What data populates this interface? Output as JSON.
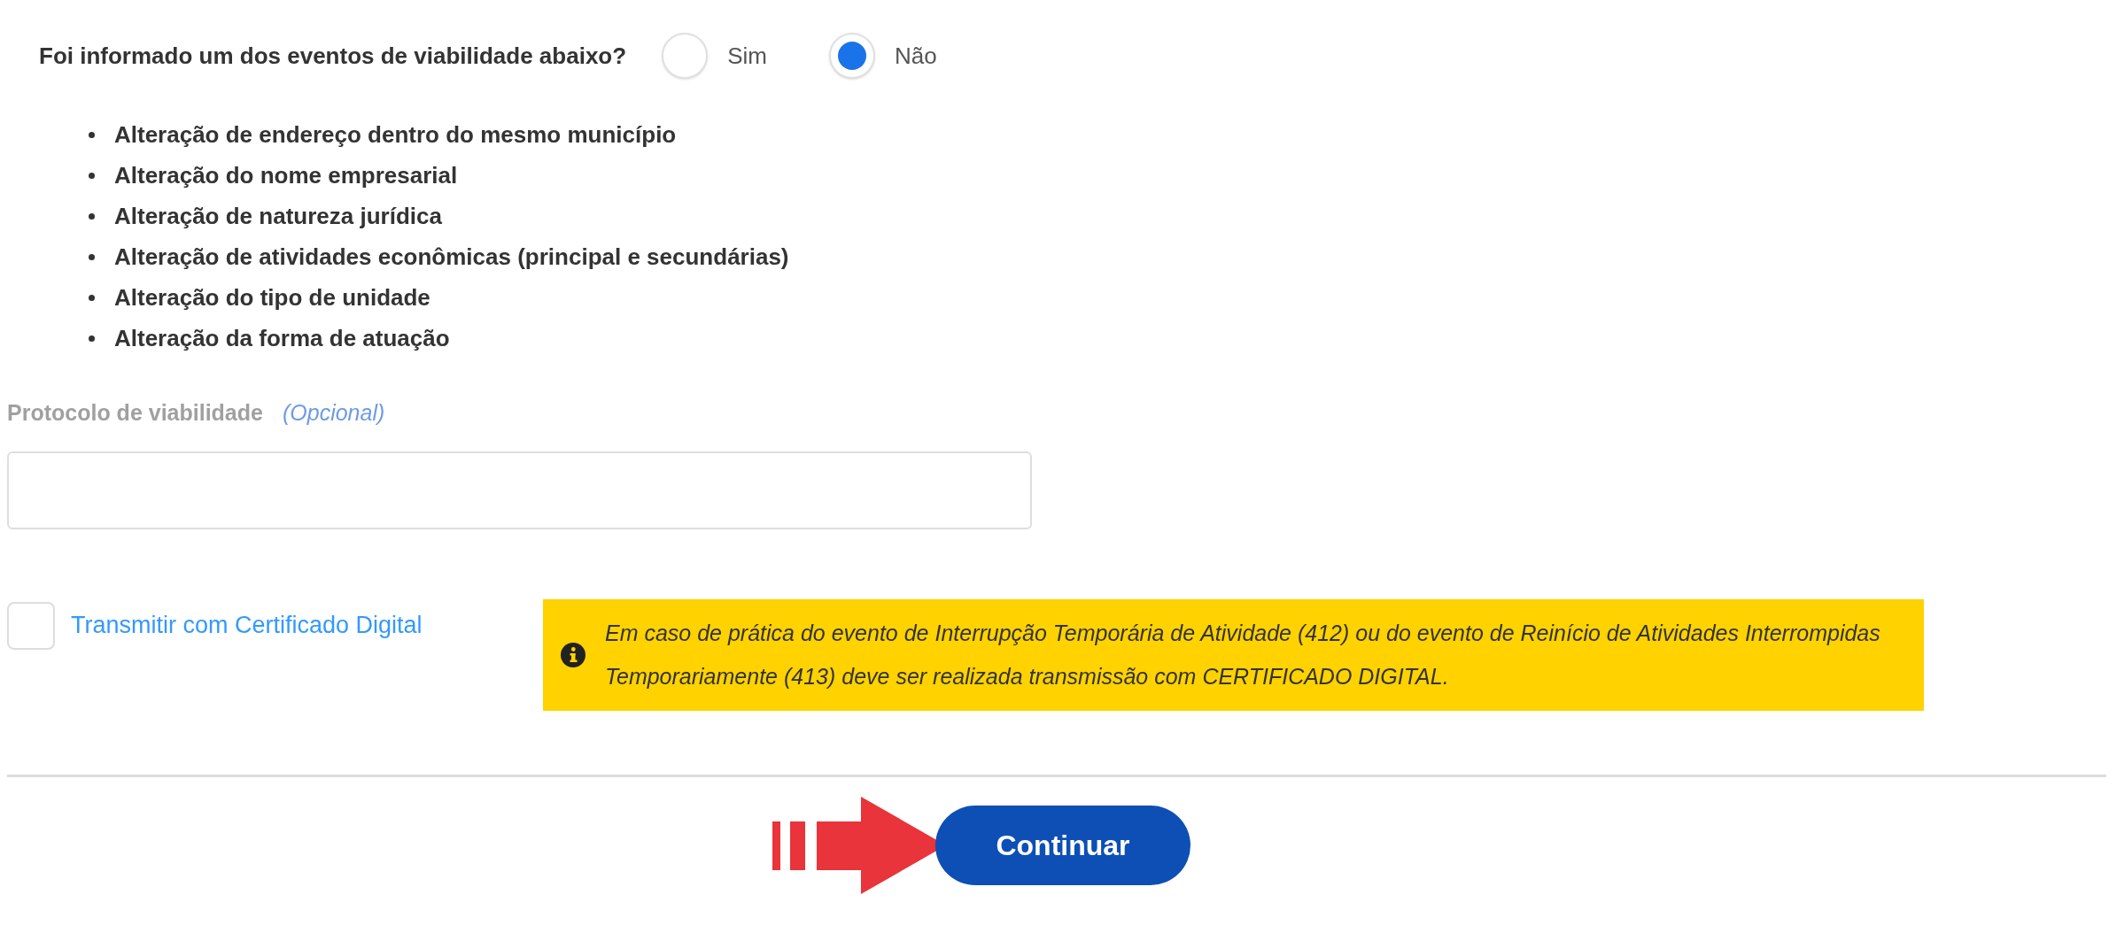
{
  "question": {
    "text": "Foi informado um dos eventos de viabilidade abaixo?",
    "options": [
      {
        "label": "Sim",
        "selected": false
      },
      {
        "label": "Não",
        "selected": true
      }
    ]
  },
  "events": [
    "Alteração de endereço dentro do mesmo município",
    "Alteração do nome empresarial",
    "Alteração de natureza jurídica",
    "Alteração de atividades econômicas (principal e secundárias)",
    "Alteração do tipo de unidade",
    "Alteração da forma de atuação"
  ],
  "protocol": {
    "label": "Protocolo de viabilidade",
    "hint": "(Opcional)"
  },
  "certificate": {
    "label": "Transmitir com Certificado Digital",
    "checked": false
  },
  "notice": {
    "text": "Em caso de prática do evento de Interrupção Temporária de Atividade (412) ou do evento de Reinício de Atividades Interrompidas Temporariamente (413) deve ser realizada transmissão com CERTIFICADO DIGITAL."
  },
  "button": {
    "label": "Continuar"
  }
}
